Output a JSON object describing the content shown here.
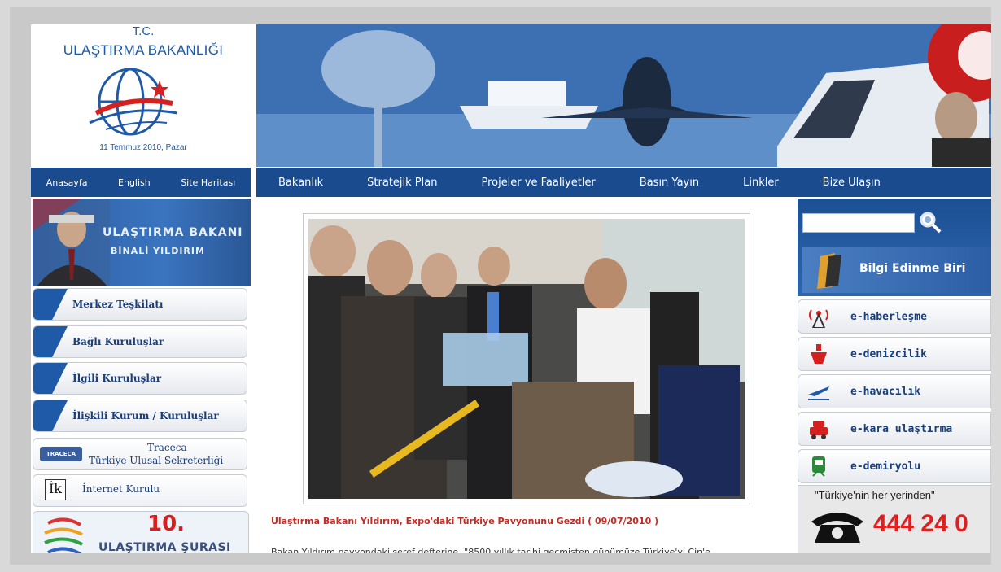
{
  "header": {
    "logo_line1": "T.C.",
    "logo_line2": "ULAŞTIRMA BAKANLIĞI",
    "date": "11 Temmuz 2010, Pazar"
  },
  "left_nav": {
    "items": [
      "Anasayfa",
      "English",
      "Site Haritası"
    ]
  },
  "main_nav": {
    "items": [
      "Bakanlık",
      "Stratejik Plan",
      "Projeler ve Faaliyetler",
      "Basın Yayın",
      "Linkler",
      "Bize Ulaşın"
    ]
  },
  "minister_banner": {
    "line1": "ULAŞTIRMA BAKANI",
    "line2": "BİNALİ YILDIRIM"
  },
  "left_menu": {
    "items": [
      "Merkez Teşkilatı",
      "Bağlı Kuruluşlar",
      "İlgili Kuruluşlar",
      "İlişkili Kurum / Kuruluşlar"
    ],
    "traceca_line1": "Traceca",
    "traceca_line2": "Türkiye Ulusal Sekreterliği",
    "traceca_logo": "TRACECA",
    "internet_logo": "İk",
    "internet_label": "İnternet Kurulu",
    "sura_number": "10.",
    "sura_label": "ULAŞTIRMA ŞURASI"
  },
  "news": {
    "headline": "Ulaştırma Bakanı Yıldırım, Expo'daki Türkiye Pavyonunu Gezdi ( 09/07/2010 )",
    "body": "Bakan Yıldırım pavyondaki şeref defterine, \"8500 yıllık tarihi geçmişten günümüze Türkiye'yi Çin'e"
  },
  "right": {
    "search_placeholder": "",
    "bilgi_label": "Bilgi Edinme Biri",
    "e_services": [
      "e-haberleşme",
      "e-denizcilik",
      "e-havacılık",
      "e-kara ulaştırma",
      "e-demiryolu"
    ],
    "hotline_caption": "\"Türkiye'nin her yerinden\"",
    "hotline_number": "444 24 0"
  },
  "colors": {
    "nav_blue": "#1a4b8e",
    "brand_blue": "#1f5aa8",
    "headline_red": "#c62a22",
    "hotline_red": "#e02020"
  }
}
